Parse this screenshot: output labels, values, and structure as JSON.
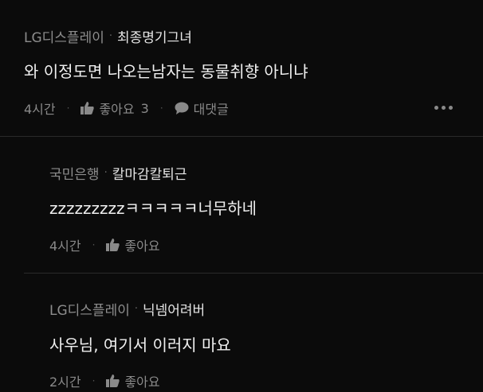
{
  "comments": [
    {
      "company": "LG디스플레이",
      "separator": "·",
      "nickname": "최종명기그녀",
      "text": "와 이정도면 나오는남자는 동물취향 아니냐",
      "time": "4시간",
      "like_label": "좋아요",
      "like_count": "3",
      "reply_label": "대댓글"
    },
    {
      "company": "국민은행",
      "separator": "·",
      "nickname": "칼마감칼퇴근",
      "text": "zzzzzzzzzㅋㅋㅋㅋㅋ너무하네",
      "time": "4시간",
      "like_label": "좋아요"
    },
    {
      "company": "LG디스플레이",
      "separator": "·",
      "nickname": "닉넴어려버",
      "text": "사우님, 여기서 이러지 마요",
      "time": "2시간",
      "like_label": "좋아요"
    }
  ],
  "icons": {
    "like": "thumbs-up-icon",
    "reply": "speech-bubble-icon",
    "more": "more-options-icon"
  },
  "colors": {
    "background": "#0b0b0b",
    "muted_text": "#8a8a8a",
    "primary_text": "#f0f0f0",
    "divider": "#2a2a2a"
  }
}
